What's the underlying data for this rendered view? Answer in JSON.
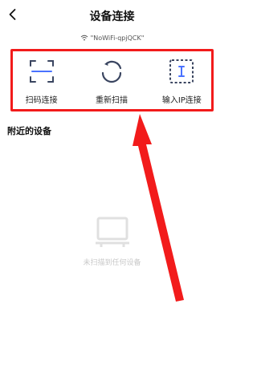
{
  "header": {
    "title": "设备连接",
    "back_icon": "chevron-left-icon"
  },
  "wifi": {
    "icon": "wifi-icon",
    "ssid_text": "\"NoWiFi-qpjQCK\""
  },
  "actions": [
    {
      "label": "扫码连接",
      "icon": "scan-qr-icon"
    },
    {
      "label": "重新扫描",
      "icon": "refresh-icon"
    },
    {
      "label": "输入IP连接",
      "icon": "ip-input-icon"
    }
  ],
  "nearby": {
    "section_title": "附近的设备"
  },
  "empty_state": {
    "icon": "tv-icon",
    "message": "未扫描到任何设备"
  },
  "colors": {
    "highlight": "#f21b1b",
    "icon_stroke": "#3a4560",
    "muted": "#c9c9c9"
  }
}
